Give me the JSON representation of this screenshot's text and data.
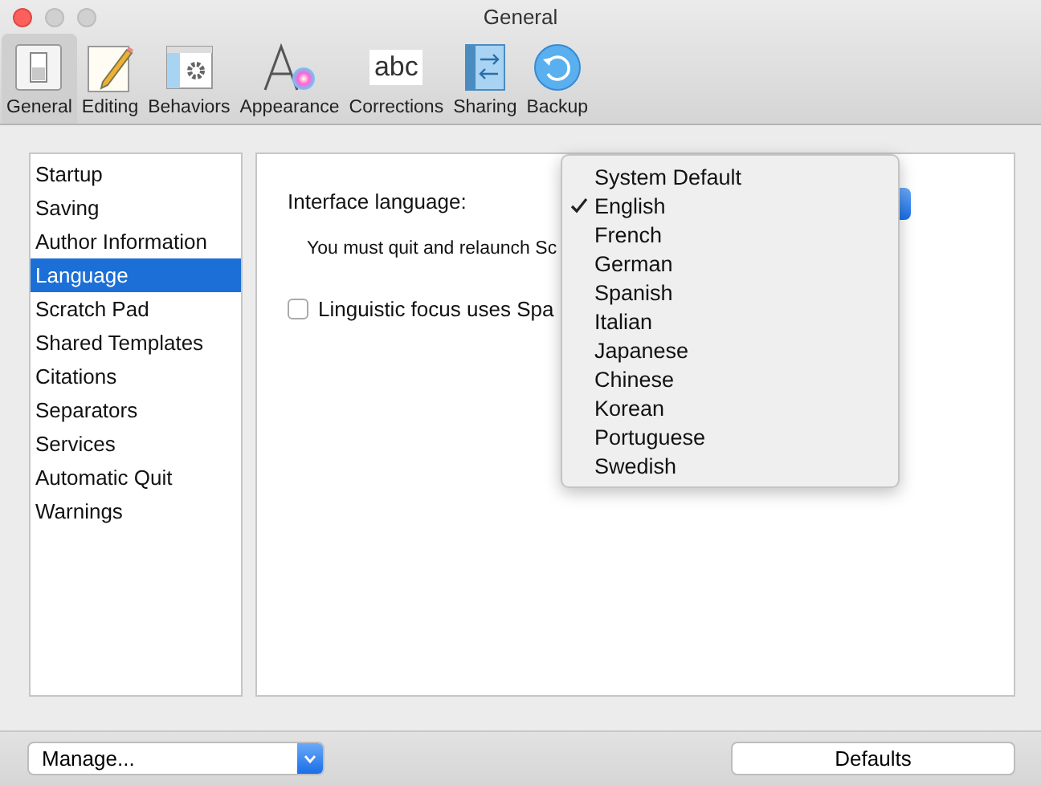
{
  "window": {
    "title": "General"
  },
  "toolbar": [
    {
      "label": "General",
      "selected": true
    },
    {
      "label": "Editing",
      "selected": false
    },
    {
      "label": "Behaviors",
      "selected": false
    },
    {
      "label": "Appearance",
      "selected": false
    },
    {
      "label": "Corrections",
      "selected": false,
      "icon_text": "abc"
    },
    {
      "label": "Sharing",
      "selected": false
    },
    {
      "label": "Backup",
      "selected": false
    }
  ],
  "sidebar": {
    "items": [
      {
        "label": "Startup",
        "selected": false
      },
      {
        "label": "Saving",
        "selected": false
      },
      {
        "label": "Author Information",
        "selected": false
      },
      {
        "label": "Language",
        "selected": true
      },
      {
        "label": "Scratch Pad",
        "selected": false
      },
      {
        "label": "Shared Templates",
        "selected": false
      },
      {
        "label": "Citations",
        "selected": false
      },
      {
        "label": "Separators",
        "selected": false
      },
      {
        "label": "Services",
        "selected": false
      },
      {
        "label": "Automatic Quit",
        "selected": false
      },
      {
        "label": "Warnings",
        "selected": false
      }
    ]
  },
  "panel": {
    "language_label": "Interface language:",
    "note": "You must quit and relaunch Sc",
    "checkbox": {
      "label": "Linguistic focus uses Spa",
      "checked": false
    }
  },
  "language_menu": {
    "items": [
      {
        "label": "System Default",
        "selected": false
      },
      {
        "label": "English",
        "selected": true
      },
      {
        "label": "French",
        "selected": false
      },
      {
        "label": "German",
        "selected": false
      },
      {
        "label": "Spanish",
        "selected": false
      },
      {
        "label": "Italian",
        "selected": false
      },
      {
        "label": "Japanese",
        "selected": false
      },
      {
        "label": "Chinese",
        "selected": false
      },
      {
        "label": "Korean",
        "selected": false
      },
      {
        "label": "Portuguese",
        "selected": false
      },
      {
        "label": "Swedish",
        "selected": false
      }
    ]
  },
  "footer": {
    "manage": "Manage...",
    "defaults": "Defaults"
  }
}
